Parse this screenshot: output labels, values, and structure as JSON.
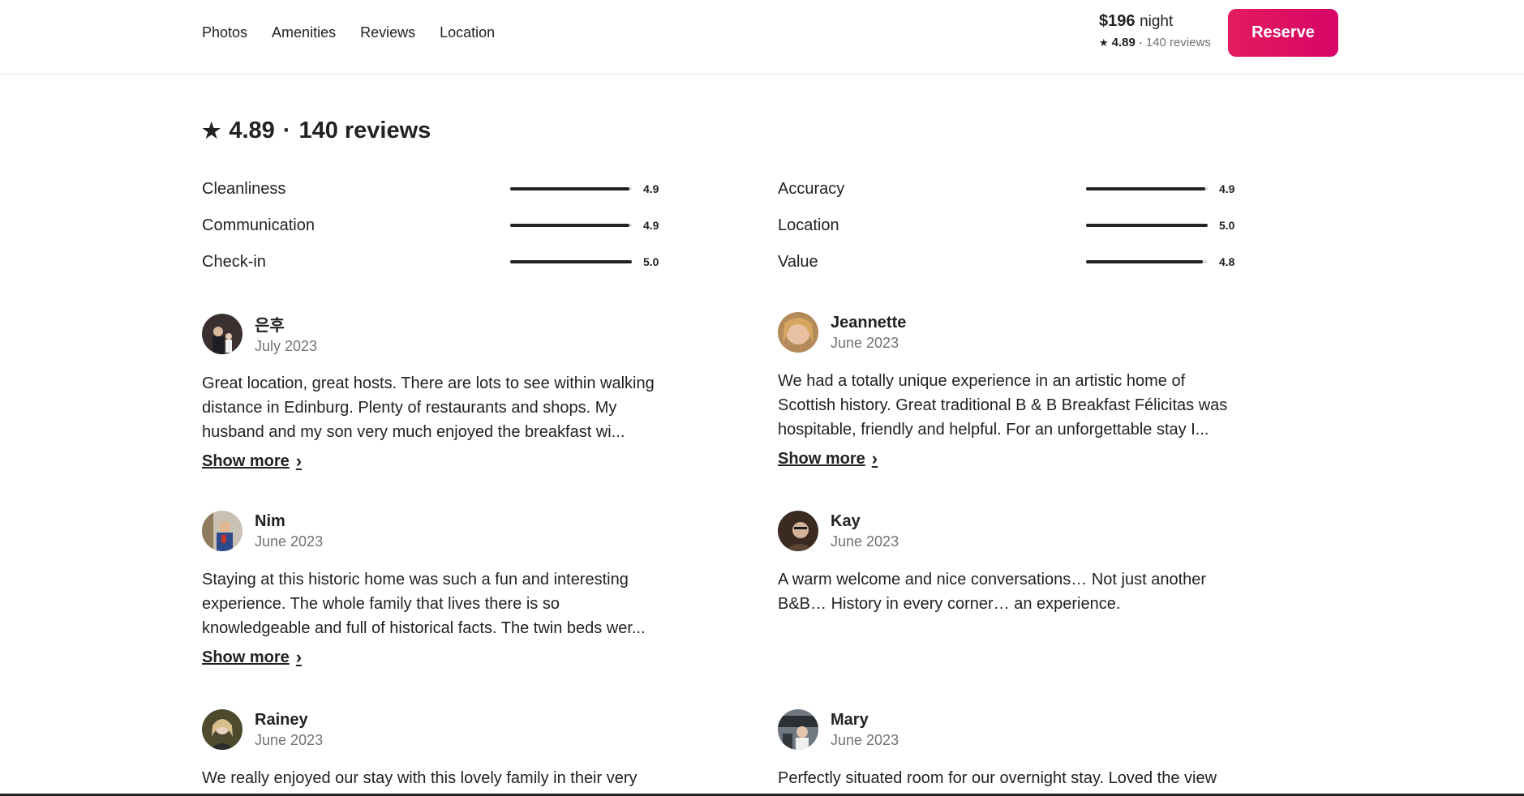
{
  "nav": {
    "items": [
      "Photos",
      "Amenities",
      "Reviews",
      "Location"
    ]
  },
  "booking": {
    "price": "$196",
    "per": "night",
    "rating": "4.89",
    "separator": "·",
    "reviews_count": "140 reviews",
    "reserve_label": "Reserve",
    "accent_color": "#e31c5f"
  },
  "summary": {
    "rating": "4.89",
    "separator": "·",
    "reviews_count": "140 reviews"
  },
  "categories": [
    {
      "label": "Cleanliness",
      "value": "4.9",
      "score": 4.9
    },
    {
      "label": "Accuracy",
      "value": "4.9",
      "score": 4.9
    },
    {
      "label": "Communication",
      "value": "4.9",
      "score": 4.9
    },
    {
      "label": "Location",
      "value": "5.0",
      "score": 5.0
    },
    {
      "label": "Check-in",
      "value": "5.0",
      "score": 5.0
    },
    {
      "label": "Value",
      "value": "4.8",
      "score": 4.8
    }
  ],
  "reviews": [
    {
      "name": "은후",
      "date": "July 2023",
      "text": "Great location, great hosts. There are lots to see within walking distance in Edinburg. Plenty of restaurants and shops. My husband and my son very much enjoyed the breakfast wi...",
      "show_more": "Show more"
    },
    {
      "name": "Jeannette",
      "date": "June 2023",
      "text": "We had a totally unique experience in an artistic home of Scottish history. Great traditional B & B Breakfast Félicitas was hospitable, friendly and helpful. For an unforgettable stay I...",
      "show_more": "Show more"
    },
    {
      "name": "Nim",
      "date": "June 2023",
      "text": "Staying at this historic home was such a fun and interesting experience. The whole family that lives there is so knowledgeable and full of historical facts. The twin beds wer...",
      "show_more": "Show more"
    },
    {
      "name": "Kay",
      "date": "June 2023",
      "text": "A warm welcome and nice conversations… Not just another B&B… History in every corner… an experience.",
      "show_more": ""
    },
    {
      "name": "Rainey",
      "date": "June 2023",
      "text": "We really enjoyed our stay with this lovely family in their very",
      "show_more": ""
    },
    {
      "name": "Mary",
      "date": "June 2023",
      "text": "Perfectly situated room for our overnight stay. Loved the view",
      "show_more": ""
    }
  ],
  "icons": {
    "star": "star-icon",
    "chevron": "chevron-right-icon"
  }
}
